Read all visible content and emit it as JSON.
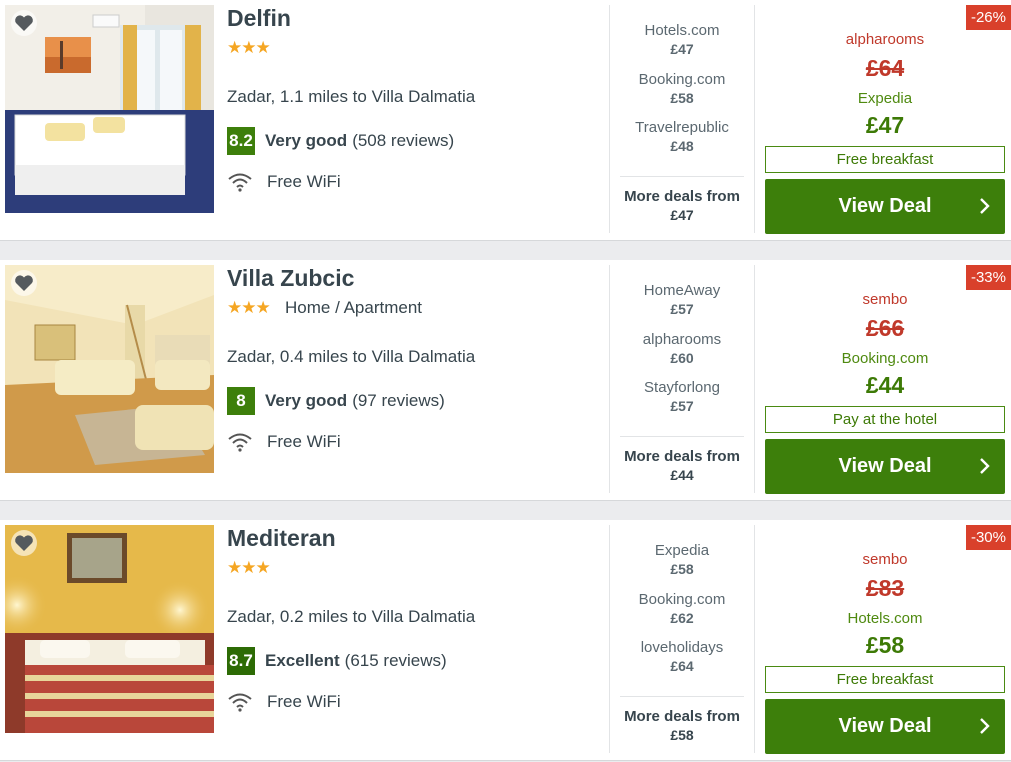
{
  "colors": {
    "score_good": "#3d7f0b",
    "score_excellent": "#2d6b05",
    "deal_button": "#3d7f0b",
    "discount_badge": "#d9402b",
    "old_price": "#c0392b",
    "new_price": "#3d7a06",
    "stars": "#f5a623"
  },
  "icons": {
    "favorite": "heart-icon",
    "wifi": "wifi-icon",
    "chevron": "chevron-right-icon"
  },
  "hotels": [
    {
      "name": "Delfin",
      "stars": "★★★",
      "type": "",
      "location": "Zadar, 1.1 miles to Villa Dalmatia",
      "score": "8.2",
      "rating_label": "Very good",
      "review_count": "(508 reviews)",
      "amenity": "Free WiFi",
      "other_deals": [
        {
          "provider": "Hotels.com",
          "price": "£47"
        },
        {
          "provider": "Booking.com",
          "price": "£58"
        },
        {
          "provider": "Travelrepublic",
          "price": "£48"
        }
      ],
      "more_label": "More deals from",
      "more_price": "£47",
      "discount": "-26%",
      "old_provider": "alpharooms",
      "old_price": "£64",
      "new_provider": "Expedia",
      "new_price": "£47",
      "perk": "Free breakfast",
      "button": "View Deal"
    },
    {
      "name": "Villa Zubcic",
      "stars": "★★★",
      "type": "Home / Apartment",
      "location": "Zadar, 0.4 miles to Villa Dalmatia",
      "score": "8",
      "rating_label": "Very good",
      "review_count": "(97 reviews)",
      "amenity": "Free WiFi",
      "other_deals": [
        {
          "provider": "HomeAway",
          "price": "£57"
        },
        {
          "provider": "alpharooms",
          "price": "£60"
        },
        {
          "provider": "Stayforlong",
          "price": "£57"
        }
      ],
      "more_label": "More deals from",
      "more_price": "£44",
      "discount": "-33%",
      "old_provider": "sembo",
      "old_price": "£66",
      "new_provider": "Booking.com",
      "new_price": "£44",
      "perk": "Pay at the hotel",
      "button": "View Deal"
    },
    {
      "name": "Mediteran",
      "stars": "★★★",
      "type": "",
      "location": "Zadar, 0.2 miles to Villa Dalmatia",
      "score": "8.7",
      "rating_label": "Excellent",
      "review_count": "(615 reviews)",
      "amenity": "Free WiFi",
      "other_deals": [
        {
          "provider": "Expedia",
          "price": "£58"
        },
        {
          "provider": "Booking.com",
          "price": "£62"
        },
        {
          "provider": "loveholidays",
          "price": "£64"
        }
      ],
      "more_label": "More deals from",
      "more_price": "£58",
      "discount": "-30%",
      "old_provider": "sembo",
      "old_price": "£83",
      "new_provider": "Hotels.com",
      "new_price": "£58",
      "perk": "Free breakfast",
      "button": "View Deal"
    }
  ]
}
